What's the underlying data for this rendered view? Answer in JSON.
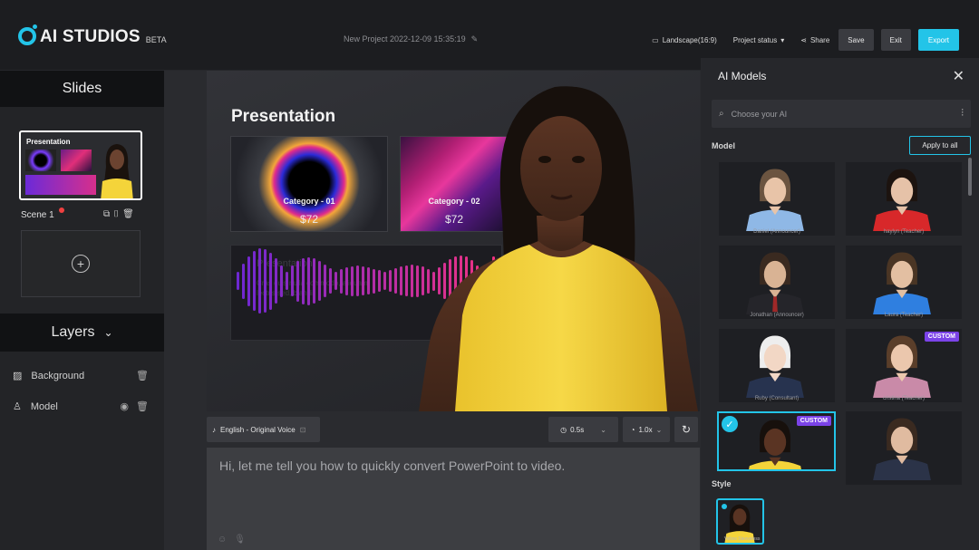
{
  "app": {
    "logo_text": "AI STUDIOS",
    "logo_badge": "BETA",
    "project_title": "New Project 2022-12-09 15:35:19"
  },
  "toolbar": {
    "aspect": "Landscape(16:9)",
    "status": "Project status",
    "share": "Share",
    "save": "Save",
    "exit": "Exit",
    "export": "Export"
  },
  "left": {
    "slides_title": "Slides",
    "scene_label": "Scene 1",
    "thumb_title": "Presentation",
    "layers_title": "Layers",
    "layers": [
      "Background",
      "Model"
    ]
  },
  "stage": {
    "title": "Presentation",
    "cards": [
      {
        "category": "Category - 01",
        "price": "$72"
      },
      {
        "category": "Category - 02",
        "price": "$72"
      }
    ],
    "wave_heading": "Presentation",
    "wave_text": "Cras quis nulla commodo, aliquam lectus sed, blandit"
  },
  "voice": {
    "label": "English - Original Voice",
    "pause": "0.5s",
    "speed": "1.0x"
  },
  "script": {
    "text": "Hi, let me tell you how to quickly convert PowerPoint to video."
  },
  "right": {
    "title": "AI Models",
    "search_placeholder": "Choose your AI",
    "model_label": "Model",
    "apply_all": "Apply to all",
    "style_label": "Style",
    "style_name": "Yellow Sleeveless",
    "models": [
      {
        "name": "Daniel (Announcer)"
      },
      {
        "name": "haylyn (Teacher)"
      },
      {
        "name": "Jonathan (Announcer)"
      },
      {
        "name": "Laura (Teacher)"
      },
      {
        "name": "Ruby (Consultant)"
      },
      {
        "name": "cristina (Teacher)",
        "tag": "CUSTOM"
      },
      {
        "name": "",
        "tag": "CUSTOM"
      },
      {
        "name": ""
      }
    ]
  },
  "colors": {
    "accent": "#23c4e8",
    "custom_tag": "#7b43e8",
    "avatar_shirt": "#f4d43a"
  }
}
